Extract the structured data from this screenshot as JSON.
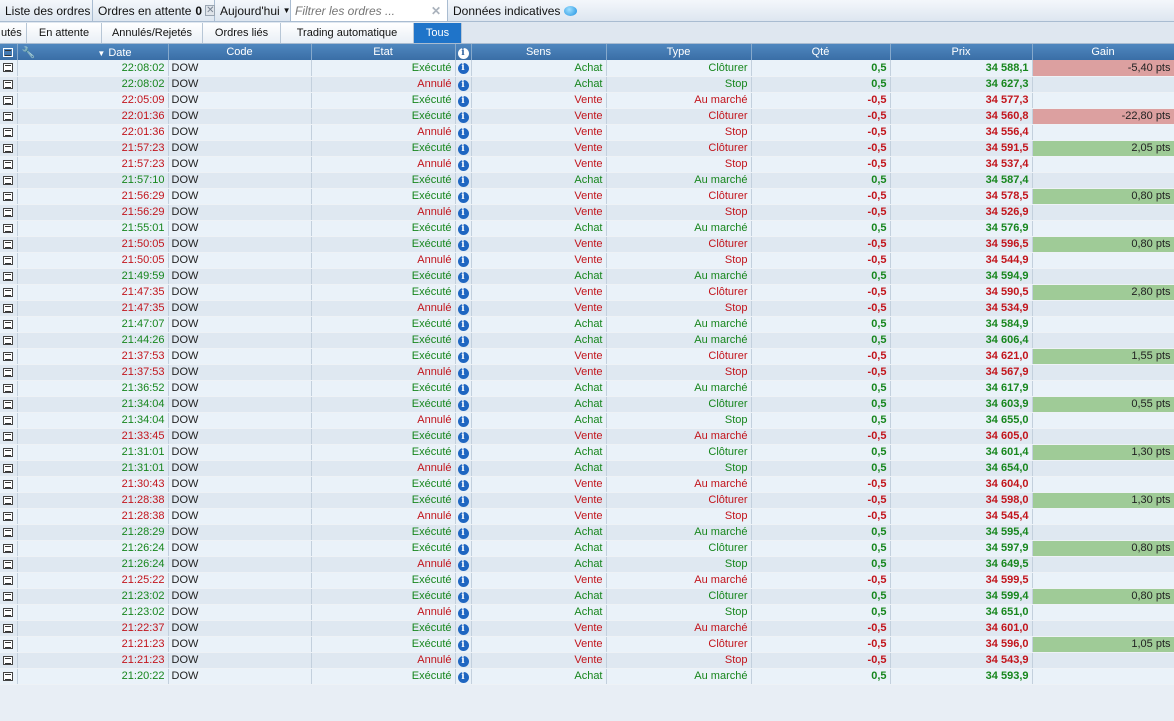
{
  "toolbar": {
    "orders_list": "Liste des ordres",
    "pending_label": "Ordres en attente",
    "pending_count": "0",
    "period": "Aujourd'hui",
    "filter_placeholder": "Filtrer les ordres ...",
    "indicative": "Données indicatives"
  },
  "tabs": [
    "utés",
    "En attente",
    "Annulés/Rejetés",
    "Ordres liés",
    "Trading automatique",
    "Tous"
  ],
  "columns": {
    "date": "Date",
    "code": "Code",
    "etat": "Etat",
    "sens": "Sens",
    "type": "Type",
    "qte": "Qté",
    "prix": "Prix",
    "gain": "Gain"
  },
  "colors": {
    "buy": "#17861d",
    "sell": "#c2141b",
    "gain_pos": "#9fcb97",
    "gain_neg": "#dca0a0",
    "active_tab": "#1f74c9"
  },
  "orders": [
    {
      "time": "22:08:02",
      "code": "DOW",
      "etat": "Exécuté",
      "sens": "Achat",
      "type": "Clôturer",
      "qte": "0,5",
      "prix": "34 588,1",
      "gain": "-5,40 pts"
    },
    {
      "time": "22:08:02",
      "code": "DOW",
      "etat": "Annulé",
      "sens": "Achat",
      "type": "Stop",
      "qte": "0,5",
      "prix": "34 627,3",
      "gain": ""
    },
    {
      "time": "22:05:09",
      "code": "DOW",
      "etat": "Exécuté",
      "sens": "Vente",
      "type": "Au marché",
      "qte": "-0,5",
      "prix": "34 577,3",
      "gain": ""
    },
    {
      "time": "22:01:36",
      "code": "DOW",
      "etat": "Exécuté",
      "sens": "Vente",
      "type": "Clôturer",
      "qte": "-0,5",
      "prix": "34 560,8",
      "gain": "-22,80 pts"
    },
    {
      "time": "22:01:36",
      "code": "DOW",
      "etat": "Annulé",
      "sens": "Vente",
      "type": "Stop",
      "qte": "-0,5",
      "prix": "34 556,4",
      "gain": ""
    },
    {
      "time": "21:57:23",
      "code": "DOW",
      "etat": "Exécuté",
      "sens": "Vente",
      "type": "Clôturer",
      "qte": "-0,5",
      "prix": "34 591,5",
      "gain": "2,05 pts"
    },
    {
      "time": "21:57:23",
      "code": "DOW",
      "etat": "Annulé",
      "sens": "Vente",
      "type": "Stop",
      "qte": "-0,5",
      "prix": "34 537,4",
      "gain": ""
    },
    {
      "time": "21:57:10",
      "code": "DOW",
      "etat": "Exécuté",
      "sens": "Achat",
      "type": "Au marché",
      "qte": "0,5",
      "prix": "34 587,4",
      "gain": ""
    },
    {
      "time": "21:56:29",
      "code": "DOW",
      "etat": "Exécuté",
      "sens": "Vente",
      "type": "Clôturer",
      "qte": "-0,5",
      "prix": "34 578,5",
      "gain": "0,80 pts"
    },
    {
      "time": "21:56:29",
      "code": "DOW",
      "etat": "Annulé",
      "sens": "Vente",
      "type": "Stop",
      "qte": "-0,5",
      "prix": "34 526,9",
      "gain": ""
    },
    {
      "time": "21:55:01",
      "code": "DOW",
      "etat": "Exécuté",
      "sens": "Achat",
      "type": "Au marché",
      "qte": "0,5",
      "prix": "34 576,9",
      "gain": ""
    },
    {
      "time": "21:50:05",
      "code": "DOW",
      "etat": "Exécuté",
      "sens": "Vente",
      "type": "Clôturer",
      "qte": "-0,5",
      "prix": "34 596,5",
      "gain": "0,80 pts"
    },
    {
      "time": "21:50:05",
      "code": "DOW",
      "etat": "Annulé",
      "sens": "Vente",
      "type": "Stop",
      "qte": "-0,5",
      "prix": "34 544,9",
      "gain": ""
    },
    {
      "time": "21:49:59",
      "code": "DOW",
      "etat": "Exécuté",
      "sens": "Achat",
      "type": "Au marché",
      "qte": "0,5",
      "prix": "34 594,9",
      "gain": ""
    },
    {
      "time": "21:47:35",
      "code": "DOW",
      "etat": "Exécuté",
      "sens": "Vente",
      "type": "Clôturer",
      "qte": "-0,5",
      "prix": "34 590,5",
      "gain": "2,80 pts"
    },
    {
      "time": "21:47:35",
      "code": "DOW",
      "etat": "Annulé",
      "sens": "Vente",
      "type": "Stop",
      "qte": "-0,5",
      "prix": "34 534,9",
      "gain": ""
    },
    {
      "time": "21:47:07",
      "code": "DOW",
      "etat": "Exécuté",
      "sens": "Achat",
      "type": "Au marché",
      "qte": "0,5",
      "prix": "34 584,9",
      "gain": ""
    },
    {
      "time": "21:44:26",
      "code": "DOW",
      "etat": "Exécuté",
      "sens": "Achat",
      "type": "Au marché",
      "qte": "0,5",
      "prix": "34 606,4",
      "gain": ""
    },
    {
      "time": "21:37:53",
      "code": "DOW",
      "etat": "Exécuté",
      "sens": "Vente",
      "type": "Clôturer",
      "qte": "-0,5",
      "prix": "34 621,0",
      "gain": "1,55 pts"
    },
    {
      "time": "21:37:53",
      "code": "DOW",
      "etat": "Annulé",
      "sens": "Vente",
      "type": "Stop",
      "qte": "-0,5",
      "prix": "34 567,9",
      "gain": ""
    },
    {
      "time": "21:36:52",
      "code": "DOW",
      "etat": "Exécuté",
      "sens": "Achat",
      "type": "Au marché",
      "qte": "0,5",
      "prix": "34 617,9",
      "gain": ""
    },
    {
      "time": "21:34:04",
      "code": "DOW",
      "etat": "Exécuté",
      "sens": "Achat",
      "type": "Clôturer",
      "qte": "0,5",
      "prix": "34 603,9",
      "gain": "0,55 pts"
    },
    {
      "time": "21:34:04",
      "code": "DOW",
      "etat": "Annulé",
      "sens": "Achat",
      "type": "Stop",
      "qte": "0,5",
      "prix": "34 655,0",
      "gain": ""
    },
    {
      "time": "21:33:45",
      "code": "DOW",
      "etat": "Exécuté",
      "sens": "Vente",
      "type": "Au marché",
      "qte": "-0,5",
      "prix": "34 605,0",
      "gain": ""
    },
    {
      "time": "21:31:01",
      "code": "DOW",
      "etat": "Exécuté",
      "sens": "Achat",
      "type": "Clôturer",
      "qte": "0,5",
      "prix": "34 601,4",
      "gain": "1,30 pts"
    },
    {
      "time": "21:31:01",
      "code": "DOW",
      "etat": "Annulé",
      "sens": "Achat",
      "type": "Stop",
      "qte": "0,5",
      "prix": "34 654,0",
      "gain": ""
    },
    {
      "time": "21:30:43",
      "code": "DOW",
      "etat": "Exécuté",
      "sens": "Vente",
      "type": "Au marché",
      "qte": "-0,5",
      "prix": "34 604,0",
      "gain": ""
    },
    {
      "time": "21:28:38",
      "code": "DOW",
      "etat": "Exécuté",
      "sens": "Vente",
      "type": "Clôturer",
      "qte": "-0,5",
      "prix": "34 598,0",
      "gain": "1,30 pts"
    },
    {
      "time": "21:28:38",
      "code": "DOW",
      "etat": "Annulé",
      "sens": "Vente",
      "type": "Stop",
      "qte": "-0,5",
      "prix": "34 545,4",
      "gain": ""
    },
    {
      "time": "21:28:29",
      "code": "DOW",
      "etat": "Exécuté",
      "sens": "Achat",
      "type": "Au marché",
      "qte": "0,5",
      "prix": "34 595,4",
      "gain": ""
    },
    {
      "time": "21:26:24",
      "code": "DOW",
      "etat": "Exécuté",
      "sens": "Achat",
      "type": "Clôturer",
      "qte": "0,5",
      "prix": "34 597,9",
      "gain": "0,80 pts"
    },
    {
      "time": "21:26:24",
      "code": "DOW",
      "etat": "Annulé",
      "sens": "Achat",
      "type": "Stop",
      "qte": "0,5",
      "prix": "34 649,5",
      "gain": ""
    },
    {
      "time": "21:25:22",
      "code": "DOW",
      "etat": "Exécuté",
      "sens": "Vente",
      "type": "Au marché",
      "qte": "-0,5",
      "prix": "34 599,5",
      "gain": ""
    },
    {
      "time": "21:23:02",
      "code": "DOW",
      "etat": "Exécuté",
      "sens": "Achat",
      "type": "Clôturer",
      "qte": "0,5",
      "prix": "34 599,4",
      "gain": "0,80 pts"
    },
    {
      "time": "21:23:02",
      "code": "DOW",
      "etat": "Annulé",
      "sens": "Achat",
      "type": "Stop",
      "qte": "0,5",
      "prix": "34 651,0",
      "gain": ""
    },
    {
      "time": "21:22:37",
      "code": "DOW",
      "etat": "Exécuté",
      "sens": "Vente",
      "type": "Au marché",
      "qte": "-0,5",
      "prix": "34 601,0",
      "gain": ""
    },
    {
      "time": "21:21:23",
      "code": "DOW",
      "etat": "Exécuté",
      "sens": "Vente",
      "type": "Clôturer",
      "qte": "-0,5",
      "prix": "34 596,0",
      "gain": "1,05 pts"
    },
    {
      "time": "21:21:23",
      "code": "DOW",
      "etat": "Annulé",
      "sens": "Vente",
      "type": "Stop",
      "qte": "-0,5",
      "prix": "34 543,9",
      "gain": ""
    },
    {
      "time": "21:20:22",
      "code": "DOW",
      "etat": "Exécuté",
      "sens": "Achat",
      "type": "Au marché",
      "qte": "0,5",
      "prix": "34 593,9",
      "gain": ""
    }
  ]
}
